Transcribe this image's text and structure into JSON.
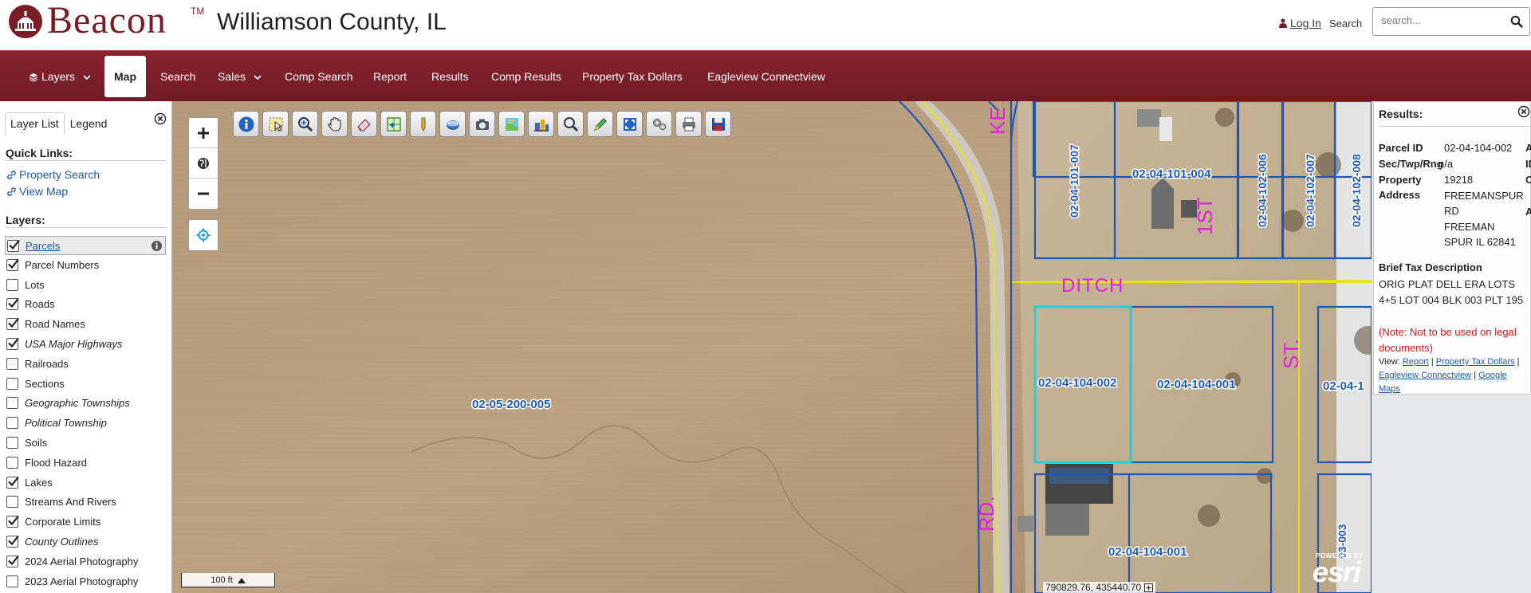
{
  "header": {
    "logo_text": "Beacon",
    "logo_tm": "TM",
    "county": "Williamson County, IL",
    "login": "Log In",
    "search_label": "Search",
    "search_placeholder": "search..."
  },
  "nav": {
    "items": [
      {
        "label": "Layers",
        "has_caret": true
      },
      {
        "label": "Map",
        "active": true
      },
      {
        "label": "Search"
      },
      {
        "label": "Sales",
        "has_caret": true
      },
      {
        "label": "Comp Search"
      },
      {
        "label": "Report"
      },
      {
        "label": "Results"
      },
      {
        "label": "Comp Results"
      },
      {
        "label": "Property Tax Dollars"
      },
      {
        "label": "Eagleview Connectview"
      }
    ]
  },
  "sidebar": {
    "tabs": [
      "Layer List",
      "Legend"
    ],
    "active_tab": "Layer List",
    "quick_links_heading": "Quick Links:",
    "quick_links": [
      "Property Search",
      "View Map"
    ],
    "layers_heading": "Layers:",
    "layers": [
      {
        "name": "Parcels",
        "checked": true,
        "selected": true
      },
      {
        "name": "Parcel Numbers",
        "checked": true
      },
      {
        "name": "Lots",
        "checked": false
      },
      {
        "name": "Roads",
        "checked": true
      },
      {
        "name": "Road Names",
        "checked": true
      },
      {
        "name": "USA Major Highways",
        "checked": true,
        "italic": true
      },
      {
        "name": "Railroads",
        "checked": false
      },
      {
        "name": "Sections",
        "checked": false
      },
      {
        "name": "Geographic Townships",
        "checked": false,
        "italic": true
      },
      {
        "name": "Political Township",
        "checked": false,
        "italic": true
      },
      {
        "name": "Soils",
        "checked": false
      },
      {
        "name": "Flood Hazard",
        "checked": false
      },
      {
        "name": "Lakes",
        "checked": true
      },
      {
        "name": "Streams And Rivers",
        "checked": false
      },
      {
        "name": "Corporate Limits",
        "checked": true
      },
      {
        "name": "County Outlines",
        "checked": true,
        "italic": true
      },
      {
        "name": "2024 Aerial Photography",
        "checked": true
      },
      {
        "name": "2023 Aerial Photography",
        "checked": false
      }
    ]
  },
  "map": {
    "parcel_labels": [
      "02-05-200-005",
      "02-04-104-002",
      "02-04-104-001",
      "02-04-104-001",
      "02-04-101-004",
      "02-04-101-007",
      "02-04-102-006",
      "02-04-102-007",
      "02-04-102-008",
      "02-04-1",
      "03-003"
    ],
    "street_labels": [
      "KE",
      "DITCH",
      "1ST",
      "ST.",
      "RD."
    ],
    "scale": "100 ft",
    "coordinates": "790829.76, 435440.70",
    "esri_powered": "POWERED BY",
    "esri_word": "esri",
    "toolbar": [
      "info-icon",
      "select-icon",
      "zoom-in-icon",
      "pan-icon",
      "eraser-icon",
      "grid-select-icon",
      "pencil-marker-icon",
      "globe-icon",
      "camera-icon",
      "overlay-icon",
      "buildings-icon",
      "magnify-icon",
      "draw-icon",
      "fullscreen-icon",
      "settings-icon",
      "print-icon",
      "save-icon"
    ]
  },
  "results": {
    "title": "Results:",
    "fields": {
      "parcel_id_label": "Parcel ID",
      "parcel_id": "02-04-104-002",
      "sec_label": "Sec/Twp/Rng",
      "sec": "n/a",
      "address_label": "Property Address",
      "address_label_1": "Property",
      "address_label_2": "Address",
      "address_lines": [
        "19218",
        "FREEMANSPUR",
        "RD",
        "FREEMAN",
        "SPUR IL 62841"
      ],
      "overflow_1": "Al",
      "overflow_2": "ID",
      "overflow_3": "Cl",
      "overflow_4": "Ac"
    },
    "tax_heading": "Brief Tax Description",
    "tax_description": "ORIG PLAT DELL ERA LOTS 4+5 LOT 004 BLK 003 PLT 195",
    "tax_note": "(Note: Not to be used on legal documents)",
    "view_prefix": "View:",
    "view_links": [
      "Report",
      "Property Tax Dollars",
      "Eagleview Connectview",
      "Google Maps"
    ]
  },
  "colors": {
    "brand": "#7a1d24",
    "nav_bg": "#7c1f2a",
    "link": "#1e5aa6",
    "parcel_line": "#1f56b8",
    "street_label": "#e41ee0",
    "road_line": "#e8e21e",
    "selected_parcel": "#19d4dc",
    "note": "#d61313"
  }
}
